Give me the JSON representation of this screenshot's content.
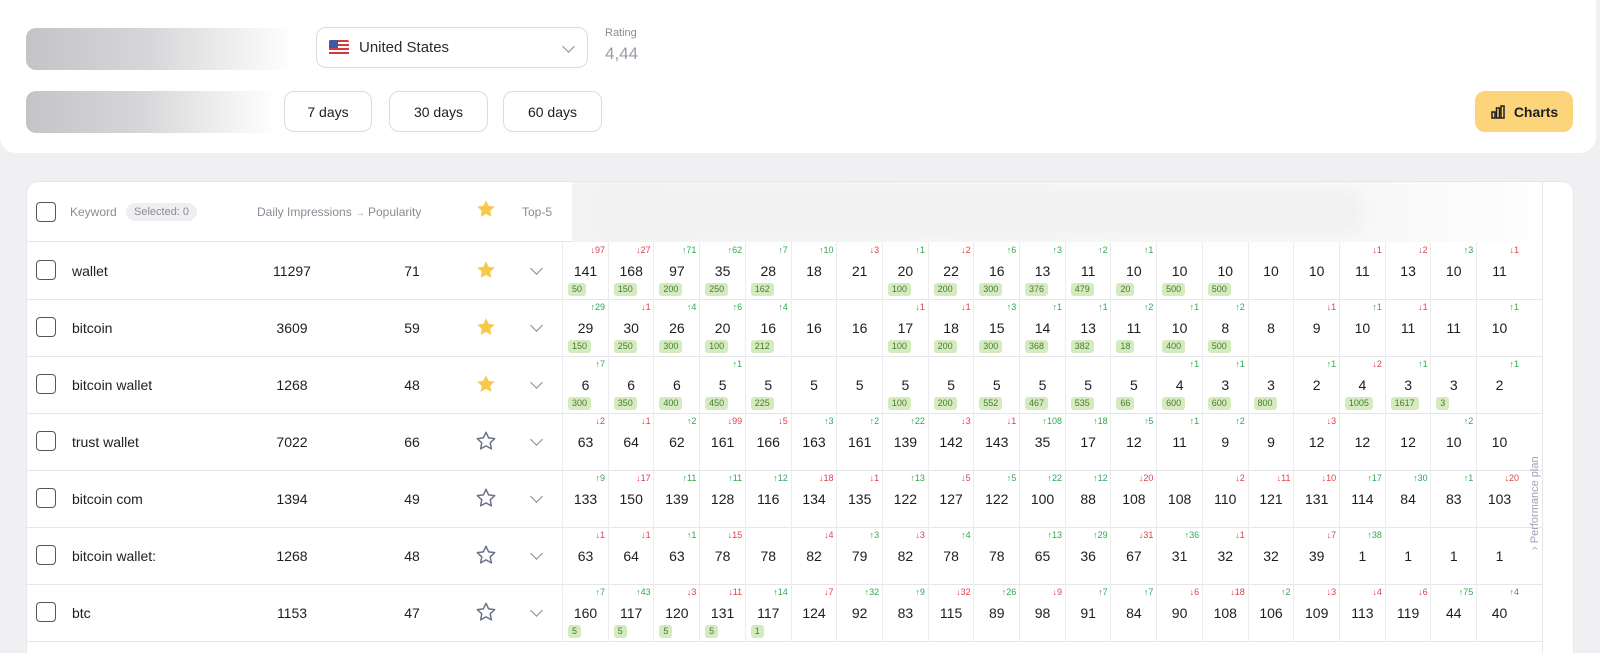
{
  "filters": {
    "country": "United States",
    "rating_label": "Rating",
    "rating_value": "4,44",
    "periods": [
      "7 days",
      "30 days",
      "60 days"
    ],
    "charts_label": "Charts"
  },
  "table": {
    "headers": {
      "keyword": "Keyword",
      "selected": "Selected: 0",
      "impressions": "Daily Impressions",
      "popularity": "Popularity",
      "top5": "Top-5"
    },
    "side_label": "Performance plan",
    "rows": [
      {
        "keyword": "wallet",
        "impressions": "11297",
        "popularity": "71",
        "starred": true,
        "cells": [
          {
            "chg": "↓97",
            "pos": "141",
            "badge": "50"
          },
          {
            "chg": "↓27",
            "pos": "168",
            "badge": "150"
          },
          {
            "chg": "↑71",
            "pos": "97",
            "badge": "200"
          },
          {
            "chg": "↑62",
            "pos": "35",
            "badge": "250"
          },
          {
            "chg": "↑7",
            "pos": "28",
            "badge": "162"
          },
          {
            "chg": "↑10",
            "pos": "18"
          },
          {
            "chg": "↓3",
            "pos": "21"
          },
          {
            "chg": "↑1",
            "pos": "20",
            "badge": "100"
          },
          {
            "chg": "↓2",
            "pos": "22",
            "badge": "200"
          },
          {
            "chg": "↑6",
            "pos": "16",
            "badge": "300"
          },
          {
            "chg": "↑3",
            "pos": "13",
            "badge": "376"
          },
          {
            "chg": "↑2",
            "pos": "11",
            "badge": "479"
          },
          {
            "chg": "↑1",
            "pos": "10",
            "badge": "20"
          },
          {
            "pos": "10",
            "badge": "500"
          },
          {
            "pos": "10",
            "badge": "500"
          },
          {
            "pos": "10"
          },
          {
            "pos": "10"
          },
          {
            "chg": "↓1",
            "pos": "11"
          },
          {
            "chg": "↓2",
            "pos": "13"
          },
          {
            "chg": "↑3",
            "pos": "10"
          },
          {
            "chg": "↓1",
            "pos": "11"
          }
        ]
      },
      {
        "keyword": "bitcoin",
        "impressions": "3609",
        "popularity": "59",
        "starred": true,
        "cells": [
          {
            "chg": "↑29",
            "pos": "29",
            "badge": "150"
          },
          {
            "chg": "↓1",
            "pos": "30",
            "badge": "250"
          },
          {
            "chg": "↑4",
            "pos": "26",
            "badge": "300"
          },
          {
            "chg": "↑6",
            "pos": "20",
            "badge": "100"
          },
          {
            "chg": "↑4",
            "pos": "16",
            "badge": "212"
          },
          {
            "pos": "16"
          },
          {
            "pos": "16"
          },
          {
            "chg": "↓1",
            "pos": "17",
            "badge": "100"
          },
          {
            "chg": "↓1",
            "pos": "18",
            "badge": "200"
          },
          {
            "chg": "↑3",
            "pos": "15",
            "badge": "300"
          },
          {
            "chg": "↑1",
            "pos": "14",
            "badge": "368"
          },
          {
            "chg": "↑1",
            "pos": "13",
            "badge": "382"
          },
          {
            "chg": "↑2",
            "pos": "11",
            "badge": "18"
          },
          {
            "chg": "↑1",
            "pos": "10",
            "badge": "400"
          },
          {
            "chg": "↑2",
            "pos": "8",
            "badge": "500"
          },
          {
            "pos": "8"
          },
          {
            "chg": "↓1",
            "pos": "9"
          },
          {
            "chg": "↑1",
            "pos": "10"
          },
          {
            "chg": "↓1",
            "pos": "11"
          },
          {
            "pos": "11"
          },
          {
            "chg": "↑1",
            "pos": "10"
          }
        ]
      },
      {
        "keyword": "bitcoin wallet",
        "impressions": "1268",
        "popularity": "48",
        "starred": true,
        "cells": [
          {
            "chg": "↑7",
            "pos": "6",
            "badge": "300"
          },
          {
            "pos": "6",
            "badge": "350"
          },
          {
            "pos": "6",
            "badge": "400"
          },
          {
            "chg": "↑1",
            "pos": "5",
            "badge": "450"
          },
          {
            "pos": "5",
            "badge": "225"
          },
          {
            "pos": "5"
          },
          {
            "pos": "5"
          },
          {
            "pos": "5",
            "badge": "100"
          },
          {
            "pos": "5",
            "badge": "200"
          },
          {
            "pos": "5",
            "badge": "552"
          },
          {
            "pos": "5",
            "badge": "467"
          },
          {
            "pos": "5",
            "badge": "535"
          },
          {
            "pos": "5",
            "badge": "66"
          },
          {
            "chg": "↑1",
            "pos": "4",
            "badge": "600"
          },
          {
            "chg": "↑1",
            "pos": "3",
            "badge": "600"
          },
          {
            "pos": "3",
            "badge": "800"
          },
          {
            "chg": "↑1",
            "pos": "2"
          },
          {
            "chg": "↓2",
            "pos": "4",
            "badge": "1005"
          },
          {
            "chg": "↑1",
            "pos": "3",
            "badge": "1617"
          },
          {
            "pos": "3",
            "badge": "3"
          },
          {
            "chg": "↑1",
            "pos": "2"
          }
        ]
      },
      {
        "keyword": "trust wallet",
        "impressions": "7022",
        "popularity": "66",
        "starred": false,
        "cells": [
          {
            "chg": "↓2",
            "pos": "63"
          },
          {
            "chg": "↓1",
            "pos": "64"
          },
          {
            "chg": "↑2",
            "pos": "62"
          },
          {
            "chg": "↓99",
            "pos": "161"
          },
          {
            "chg": "↓5",
            "pos": "166"
          },
          {
            "chg": "↑3",
            "pos": "163"
          },
          {
            "chg": "↑2",
            "pos": "161"
          },
          {
            "chg": "↑22",
            "pos": "139"
          },
          {
            "chg": "↓3",
            "pos": "142"
          },
          {
            "chg": "↓1",
            "pos": "143"
          },
          {
            "chg": "↑108",
            "pos": "35"
          },
          {
            "chg": "↑18",
            "pos": "17"
          },
          {
            "chg": "↑5",
            "pos": "12"
          },
          {
            "chg": "↑1",
            "pos": "11"
          },
          {
            "chg": "↑2",
            "pos": "9"
          },
          {
            "pos": "9"
          },
          {
            "chg": "↓3",
            "pos": "12"
          },
          {
            "pos": "12"
          },
          {
            "pos": "12"
          },
          {
            "chg": "↑2",
            "pos": "10"
          },
          {
            "pos": "10"
          }
        ]
      },
      {
        "keyword": "bitcoin com",
        "impressions": "1394",
        "popularity": "49",
        "starred": false,
        "cells": [
          {
            "chg": "↑9",
            "pos": "133"
          },
          {
            "chg": "↓17",
            "pos": "150"
          },
          {
            "chg": "↑11",
            "pos": "139"
          },
          {
            "chg": "↑11",
            "pos": "128"
          },
          {
            "chg": "↑12",
            "pos": "116"
          },
          {
            "chg": "↓18",
            "pos": "134"
          },
          {
            "chg": "↓1",
            "pos": "135"
          },
          {
            "chg": "↑13",
            "pos": "122"
          },
          {
            "chg": "↓5",
            "pos": "127"
          },
          {
            "chg": "↑5",
            "pos": "122"
          },
          {
            "chg": "↑22",
            "pos": "100"
          },
          {
            "chg": "↑12",
            "pos": "88"
          },
          {
            "chg": "↓20",
            "pos": "108"
          },
          {
            "pos": "108"
          },
          {
            "chg": "↓2",
            "pos": "110"
          },
          {
            "chg": "↓11",
            "pos": "121"
          },
          {
            "chg": "↓10",
            "pos": "131"
          },
          {
            "chg": "↑17",
            "pos": "114"
          },
          {
            "chg": "↑30",
            "pos": "84"
          },
          {
            "chg": "↑1",
            "pos": "83"
          },
          {
            "chg": "↓20",
            "pos": "103"
          }
        ]
      },
      {
        "keyword": "bitcoin wallet:",
        "impressions": "1268",
        "popularity": "48",
        "starred": false,
        "cells": [
          {
            "chg": "↓1",
            "pos": "63"
          },
          {
            "chg": "↓1",
            "pos": "64"
          },
          {
            "chg": "↑1",
            "pos": "63"
          },
          {
            "chg": "↓15",
            "pos": "78"
          },
          {
            "pos": "78"
          },
          {
            "chg": "↓4",
            "pos": "82"
          },
          {
            "chg": "↑3",
            "pos": "79"
          },
          {
            "chg": "↓3",
            "pos": "82"
          },
          {
            "chg": "↑4",
            "pos": "78"
          },
          {
            "pos": "78"
          },
          {
            "chg": "↑13",
            "pos": "65"
          },
          {
            "chg": "↑29",
            "pos": "36"
          },
          {
            "chg": "↓31",
            "pos": "67"
          },
          {
            "chg": "↑36",
            "pos": "31"
          },
          {
            "chg": "↓1",
            "pos": "32"
          },
          {
            "pos": "32"
          },
          {
            "chg": "↓7",
            "pos": "39"
          },
          {
            "chg": "↑38",
            "pos": "1"
          },
          {
            "pos": "1"
          },
          {
            "pos": "1"
          },
          {
            "pos": "1"
          }
        ]
      },
      {
        "keyword": "btc",
        "impressions": "1153",
        "popularity": "47",
        "starred": false,
        "cells": [
          {
            "chg": "↑7",
            "pos": "160",
            "badge": "5"
          },
          {
            "chg": "↑43",
            "pos": "117",
            "badge": "5"
          },
          {
            "chg": "↓3",
            "pos": "120",
            "badge": "5"
          },
          {
            "chg": "↓11",
            "pos": "131",
            "badge": "5"
          },
          {
            "chg": "↑14",
            "pos": "117",
            "badge": "1"
          },
          {
            "chg": "↓7",
            "pos": "124"
          },
          {
            "chg": "↑32",
            "pos": "92"
          },
          {
            "chg": "↑9",
            "pos": "83"
          },
          {
            "chg": "↓32",
            "pos": "115"
          },
          {
            "chg": "↑26",
            "pos": "89"
          },
          {
            "chg": "↓9",
            "pos": "98"
          },
          {
            "chg": "↑7",
            "pos": "91"
          },
          {
            "chg": "↑7",
            "pos": "84"
          },
          {
            "chg": "↓6",
            "pos": "90"
          },
          {
            "chg": "↓18",
            "pos": "108"
          },
          {
            "chg": "↑2",
            "pos": "106"
          },
          {
            "chg": "↓3",
            "pos": "109"
          },
          {
            "chg": "↓4",
            "pos": "113"
          },
          {
            "chg": "↓6",
            "pos": "119"
          },
          {
            "chg": "↑75",
            "pos": "44"
          },
          {
            "chg": "↑4",
            "pos": "40"
          }
        ]
      }
    ]
  },
  "colors": {
    "accent": "#fcd57a",
    "up": "#2fa84f",
    "down": "#e0404a",
    "badge": "#d4ebbf",
    "star": "#f8c84a"
  },
  "icons": {
    "star_filled": "star-filled-icon",
    "star_outline": "star-outline-icon",
    "charts": "bar-chart-icon"
  }
}
